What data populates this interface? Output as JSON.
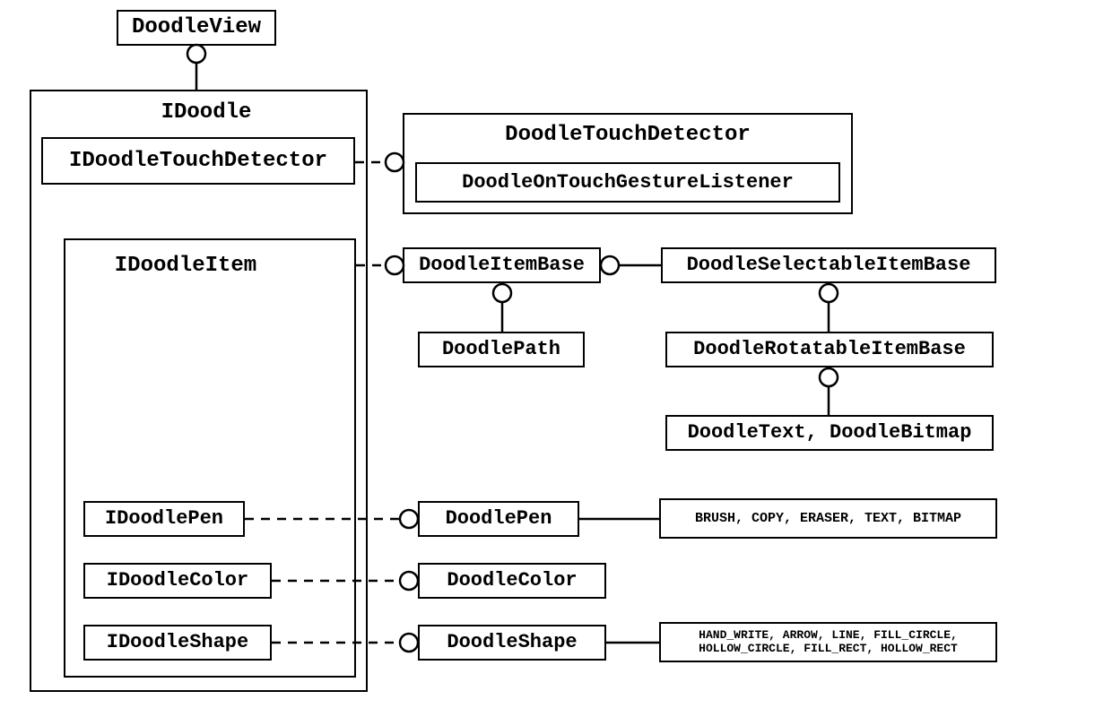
{
  "nodes": {
    "doodleView": "DoodleView",
    "iDoodle": "IDoodle",
    "iDoodleTouchDetector": "IDoodleTouchDetector",
    "doodleTouchDetector": "DoodleTouchDetector",
    "doodleOnTouchGestureListener": "DoodleOnTouchGestureListener",
    "iDoodleItem": "IDoodleItem",
    "doodleItemBase": "DoodleItemBase",
    "doodleSelectableItemBase": "DoodleSelectableItemBase",
    "doodlePath": "DoodlePath",
    "doodleRotatableItemBase": "DoodleRotatableItemBase",
    "doodleTextBitmap": "DoodleText, DoodleBitmap",
    "iDoodlePen": "IDoodlePen",
    "doodlePen": "DoodlePen",
    "penValues": "BRUSH, COPY, ERASER, TEXT, BITMAP",
    "iDoodleColor": "IDoodleColor",
    "doodleColor": "DoodleColor",
    "iDoodleShape": "IDoodleShape",
    "doodleShape": "DoodleShape",
    "shapeValues": "HAND_WRITE, ARROW, LINE, FILL_CIRCLE, HOLLOW_CIRCLE, FILL_RECT, HOLLOW_RECT"
  }
}
